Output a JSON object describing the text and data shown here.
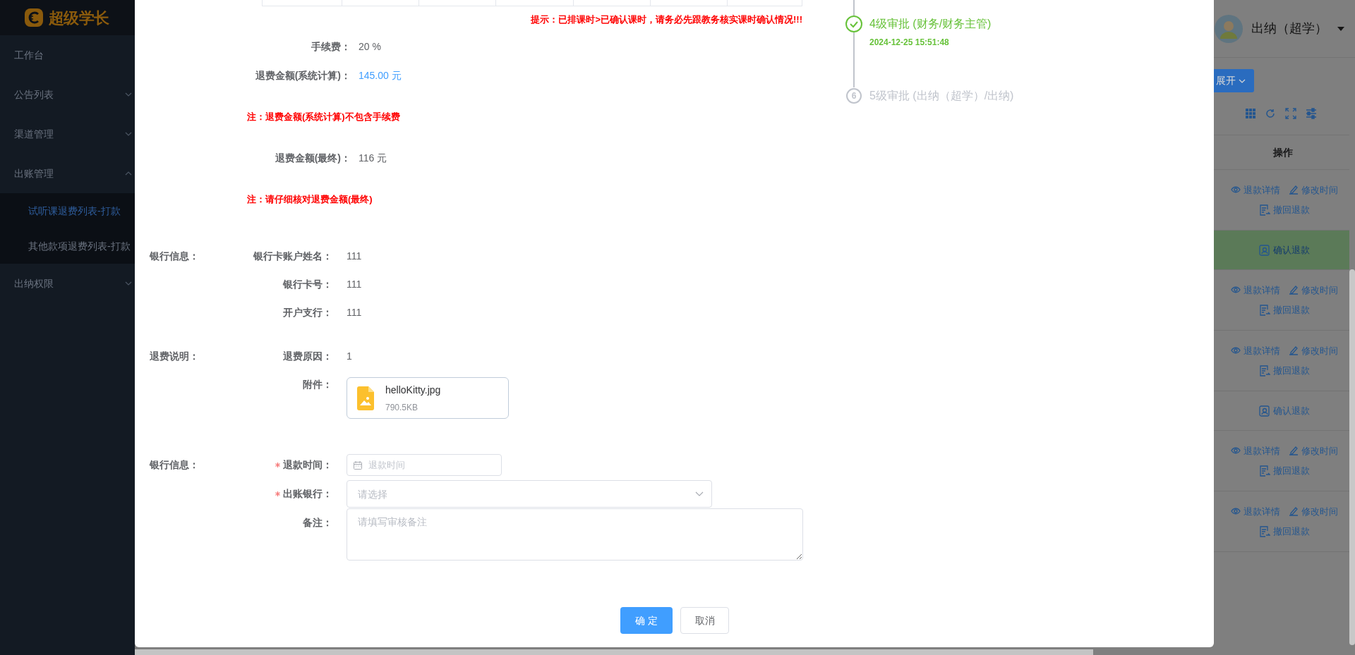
{
  "sidebar": {
    "logo": "超级学长",
    "items": [
      {
        "kind": "link",
        "label": "工作台"
      },
      {
        "kind": "menu",
        "label": "公告列表",
        "expanded": false
      },
      {
        "kind": "menu",
        "label": "渠道管理",
        "expanded": false
      },
      {
        "kind": "menu",
        "label": "出账管理",
        "expanded": true,
        "children": [
          {
            "label": "试听课退费列表-打款",
            "selected": true
          },
          {
            "label": "其他款项退费列表-打款",
            "selected": false
          }
        ]
      },
      {
        "kind": "menu",
        "label": "出纳权限",
        "expanded": false
      }
    ]
  },
  "header": {
    "user": "出纳（超学）"
  },
  "list": {
    "expand_button": "展开",
    "action_column": "操作",
    "rows": [
      {
        "highlighted": false,
        "actions": [
          {
            "kind": "detail",
            "label": "退款详情"
          },
          {
            "kind": "edit",
            "label": "修改时间"
          },
          {
            "kind": "revoke",
            "label": "撤回退款"
          }
        ]
      },
      {
        "highlighted": true,
        "actions": [
          {
            "kind": "confirm",
            "label": "确认退款"
          }
        ]
      },
      {
        "highlighted": false,
        "actions": [
          {
            "kind": "detail",
            "label": "退款详情"
          },
          {
            "kind": "edit",
            "label": "修改时间"
          },
          {
            "kind": "revoke",
            "label": "撤回退款"
          }
        ]
      },
      {
        "highlighted": false,
        "actions": [
          {
            "kind": "detail",
            "label": "退款详情"
          },
          {
            "kind": "edit",
            "label": "修改时间"
          },
          {
            "kind": "revoke",
            "label": "撤回退款"
          }
        ]
      },
      {
        "highlighted": false,
        "actions": [
          {
            "kind": "confirm",
            "label": "确认退款"
          }
        ]
      },
      {
        "highlighted": false,
        "actions": [
          {
            "kind": "detail",
            "label": "退款详情"
          },
          {
            "kind": "edit",
            "label": "修改时间"
          },
          {
            "kind": "revoke",
            "label": "撤回退款"
          }
        ]
      },
      {
        "highlighted": false,
        "actions": [
          {
            "kind": "detail",
            "label": "退款详情"
          },
          {
            "kind": "edit",
            "label": "修改时间"
          },
          {
            "kind": "revoke",
            "label": "撤回退款"
          }
        ]
      }
    ]
  },
  "dialog": {
    "notice": "提示：已排课时>已确认课时，请务必先跟教务核实课时确认情况!!!",
    "details": [
      {
        "kind": "field",
        "label": "手续费：",
        "value": "20 %",
        "emphasis": false
      },
      {
        "kind": "field",
        "label": "退费金额(系统计算)：",
        "value": "145.00 元",
        "emphasis": true
      },
      {
        "kind": "note",
        "text": "注：退费金额(系统计算)不包含手续费"
      },
      {
        "kind": "field",
        "label": "退费金额(最终)：",
        "value": "116 元",
        "emphasis": false
      },
      {
        "kind": "note",
        "text": "注：请仔细核对退费金额(最终)"
      }
    ],
    "sections": [
      {
        "title": "银行信息：",
        "rows": [
          {
            "kind": "text",
            "label": "银行卡账户姓名：",
            "value": "111"
          },
          {
            "kind": "text",
            "label": "银行卡号：",
            "value": "111"
          },
          {
            "kind": "text",
            "label": "开户支行：",
            "value": "111"
          }
        ]
      },
      {
        "title": "退费说明：",
        "rows": [
          {
            "kind": "text",
            "label": "退费原因：",
            "value": "1"
          },
          {
            "kind": "file",
            "label": "附件：",
            "file_name": "helloKitty.jpg",
            "file_size": "790.5KB"
          }
        ]
      },
      {
        "title": "银行信息：",
        "rows": [
          {
            "kind": "date",
            "label": "退款时间：",
            "required": true,
            "placeholder": "退款时间"
          },
          {
            "kind": "select",
            "label": "出账银行：",
            "required": true,
            "placeholder": "请选择"
          },
          {
            "kind": "textarea",
            "label": "备注：",
            "required": false,
            "placeholder": "请填写审核备注"
          }
        ]
      }
    ],
    "timeline": [
      {
        "completed": true,
        "title": "4级审批 (财务/财务主管)",
        "time": "2024-12-25 15:51:48"
      },
      {
        "completed": false,
        "step": "6",
        "title": "5级审批 (出纳（超学）/出纳)"
      }
    ],
    "buttons": [
      {
        "label": "确 定",
        "primary": true
      },
      {
        "label": "取消",
        "primary": false
      }
    ]
  }
}
